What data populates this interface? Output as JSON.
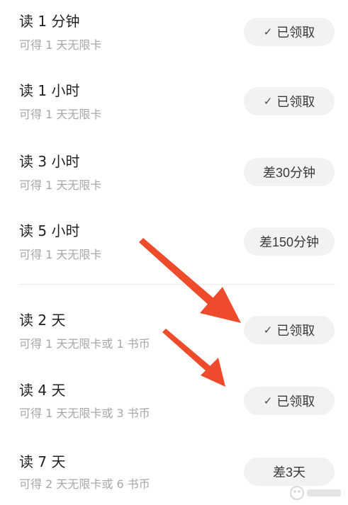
{
  "tasks": [
    {
      "title": "读 1 分钟",
      "reward": "可得 1 天无限卡",
      "button": {
        "label": "已领取",
        "checked": true
      }
    },
    {
      "title": "读 1 小时",
      "reward": "可得 1 天无限卡",
      "button": {
        "label": "已领取",
        "checked": true
      }
    },
    {
      "title": "读 3 小时",
      "reward": "可得 1 天无限卡",
      "button": {
        "label": "差30分钟",
        "checked": false
      }
    },
    {
      "title": "读 5 小时",
      "reward": "可得 1 天无限卡",
      "button": {
        "label": "差150分钟",
        "checked": false
      }
    },
    {
      "title": "读 2 天",
      "reward": "可得 1 天无限卡或 1 书币",
      "button": {
        "label": "已领取",
        "checked": true
      }
    },
    {
      "title": "读 4 天",
      "reward": "可得 1 天无限卡或 3 书币",
      "button": {
        "label": "已领取",
        "checked": true
      }
    },
    {
      "title": "读 7 天",
      "reward": "可得 2 天无限卡或 6 书币",
      "button": {
        "label": "差3天",
        "checked": false
      }
    }
  ],
  "icons": {
    "check": "✓"
  },
  "annotation_color": "#ee4a2c",
  "colors": {
    "title": "#222222",
    "subtitle": "#a7a7a7",
    "pill_bg": "#f1f2f4"
  }
}
